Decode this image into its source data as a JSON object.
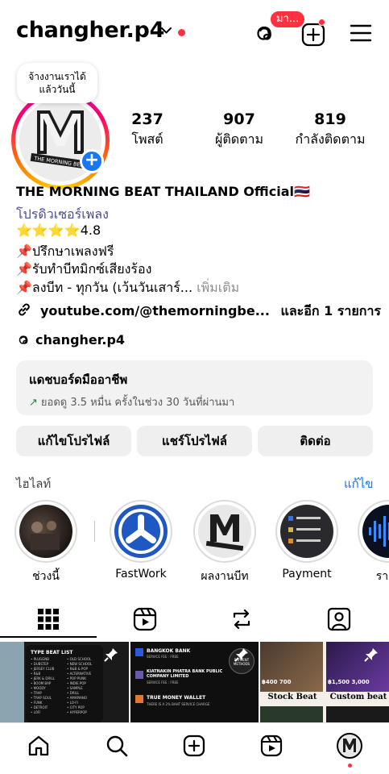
{
  "header": {
    "username": "changher.p4",
    "threads_badge": "มา...",
    "icons": [
      "chevron-down-icon",
      "threads-icon",
      "add-content-icon",
      "menu-icon"
    ]
  },
  "profile": {
    "note": "จ้างงานเราได้แล้ววันนี้",
    "note_line1": "จ้างงานเราได้",
    "note_line2": "แล้ววันนี้",
    "avatar_text": "THE MORNING BEAT",
    "stats": {
      "posts_count": "237",
      "posts_label": "โพสต์",
      "followers_count": "907",
      "followers_label": "ผู้ติดตาม",
      "following_count": "819",
      "following_label": "กำลังติดตาม"
    }
  },
  "bio": {
    "name": "THE MORNING BEAT THAILAND Official🇹🇭",
    "category": "โปรดิวเซอร์เพลง",
    "stars": "⭐⭐⭐⭐4.8",
    "line1": "📌ปรึกษาเพลงฟรี",
    "line2": "📌รับทำบีทมิกซ์เสียงร้อง",
    "line3": "📌ลงบีท - ทุกวัน (เว้นวันเสาร์...",
    "more": "เพิ่มเติม",
    "link": "youtube.com/@themorningbe...",
    "link_extra": "และอีก 1 รายการ",
    "threads_handle": "changher.p4"
  },
  "dashboard": {
    "title": "แดชบอร์ดมืออาชีพ",
    "subtitle": "ยอดดู 3.5 หมื่น ครั้งในช่วง 30 วันที่ผ่านมา",
    "accent": "#1e8a3a"
  },
  "buttons": {
    "edit": "แก้ไขโปรไฟล์",
    "share": "แชร์โปรไฟล์",
    "contact": "ติดต่อ"
  },
  "highlights": {
    "title": "ไฮไลท์",
    "edit": "แก้ไข",
    "items": [
      {
        "label": "ช่วงนี้"
      },
      {
        "label": "FastWork"
      },
      {
        "label": "ผลงานบีท"
      },
      {
        "label": "Payment"
      },
      {
        "label": "ราคา"
      }
    ]
  },
  "tabs": [
    "grid-icon",
    "reels-icon",
    "reposts-icon",
    "tagged-icon"
  ],
  "grid": {
    "post1": {
      "title": "TYPE BEAT LIST",
      "col1": [
        "PLUGGNB",
        "DUBSTEP",
        "JERSEY CLUB",
        "R&B",
        "JERK & DRILL",
        "BOOM BAP",
        "MOODY",
        "TRAP",
        "TRAP SOUL",
        "FUNK",
        "DETROIT",
        "LOFI"
      ],
      "col2": [
        "OLD SCHOOL",
        "NEW SCHOOL",
        "R&B & POP",
        "ALTERNATIVE",
        "POP PUNK",
        "INDIE POP",
        "SAMPLE",
        "DRILL",
        "AMAPIANO",
        "LO-FI",
        "CITY POP",
        "HYPERPOP"
      ]
    },
    "post2": {
      "bank1": "BANGKOK BANK",
      "fee1": "SERVICE FEE : FREE",
      "bank2": "KIATNAKIN PHATRA BANK PUBLIC COMPANY LIMITED",
      "fee2": "SERVICE FEE : FREE",
      "wallet": "TRUE MONEY WALLET",
      "wallet_note": "THERE IS A 2% BAHT SERVICE CHARGE",
      "methods": "PAYMENT METHODS"
    },
    "post3": {
      "price1": "฿400 700",
      "price2": "฿1,500 3,000",
      "label1": "Stock Beat",
      "label2": "Custom beat"
    }
  },
  "bottom_nav": [
    "home-icon",
    "search-icon",
    "create-icon",
    "reels-icon",
    "profile-avatar"
  ]
}
